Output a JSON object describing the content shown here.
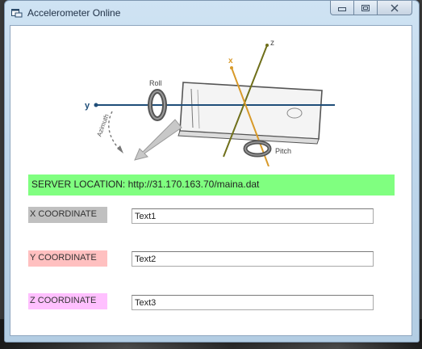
{
  "window": {
    "title": "Accelerometer Online",
    "caption_buttons": {
      "minimize": "▭",
      "maximize": "▢",
      "close": "☒"
    }
  },
  "illustration": {
    "labels": {
      "roll": "Roll",
      "pitch": "Pitch",
      "azimuth": "Azimuth",
      "x": "x",
      "y": "y",
      "z": "z"
    }
  },
  "server": {
    "text": "SERVER LOCATION: http://31.170.163.70/maina.dat"
  },
  "coordinates": [
    {
      "label": "X COORDINATE",
      "value": "Text1",
      "color": "#c0c0c0"
    },
    {
      "label": "Y COORDINATE",
      "value": "Text2",
      "color": "#ffc0c0"
    },
    {
      "label": "Z COORDINATE",
      "value": "Text3",
      "color": "#ffc0ff"
    }
  ],
  "colors": {
    "server_bar": "#80ff80",
    "window_frame": "#bfd7ec",
    "client_bg": "#ffffff"
  }
}
